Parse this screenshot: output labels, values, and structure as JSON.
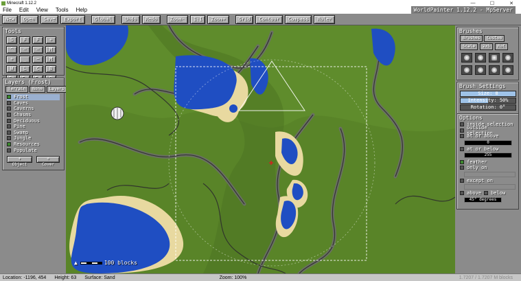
{
  "window": {
    "title": "Minecraft 1.12.2",
    "app_title": "WorldPainter 1.12.2 - MpServer"
  },
  "menu": [
    "File",
    "Edit",
    "View",
    "Tools",
    "Help"
  ],
  "toolbar": [
    {
      "label": "New"
    },
    {
      "label": "Open"
    },
    {
      "label": "Save"
    },
    {
      "label": "Export"
    },
    {
      "label": "Global"
    },
    {
      "label": "Undo"
    },
    {
      "label": "Redo"
    },
    {
      "label": "Zoom-"
    },
    {
      "label": "1:1"
    },
    {
      "label": "Zoom+"
    },
    {
      "label": "Grid"
    },
    {
      "label": "Contour"
    },
    {
      "label": "Compass"
    },
    {
      "label": "Ruler"
    }
  ],
  "tools": {
    "title": "Tools",
    "buttons": [
      "S",
      "F",
      "F",
      "+",
      "^",
      "~",
      "~",
      "M",
      "+",
      "_",
      "~",
      "M",
      "W",
      "L",
      "C",
      "B",
      "Bi",
      "Fy",
      "Er",
      "D"
    ]
  },
  "layers": {
    "title": "Layers (Frost)",
    "tabs": [
      "Terrain",
      "None",
      "Layers"
    ],
    "items": [
      {
        "name": "Frost",
        "checked": true,
        "selected": true
      },
      {
        "name": "Caves",
        "checked": false
      },
      {
        "name": "Caverns",
        "checked": false
      },
      {
        "name": "Chasms",
        "checked": false
      },
      {
        "name": "Deciduous",
        "checked": false
      },
      {
        "name": "Pine",
        "checked": false
      },
      {
        "name": "Swamp",
        "checked": false
      },
      {
        "name": "Jungle",
        "checked": false
      },
      {
        "name": "Resources",
        "checked": true
      },
      {
        "name": "Populate",
        "checked": false
      }
    ],
    "actions": [
      "+ Object",
      "+ Cover"
    ]
  },
  "brushes": {
    "title": "Brushes",
    "tabs": [
      "Brushes",
      "Custom"
    ],
    "sub": [
      "Scale",
      "2x5",
      "Rot"
    ]
  },
  "brush_settings": {
    "title": "Brush Settings",
    "size_label": "Size: 8",
    "intensity_label": "Intensity: 50%",
    "intensity": 0.5,
    "rotation_label": "Rotation: 0°",
    "size": 0.08
  },
  "options": {
    "title": "Options",
    "inside_selection": "inside selection",
    "outside_selection": "outside selection",
    "at_or_above": "at or above",
    "at_or_above_value": "0",
    "at_or_below": "at or below",
    "at_or_below_value": "255",
    "feather": "feather",
    "only_on": "only on",
    "except_on": "except on",
    "above": "above",
    "below": "below",
    "degrees": "45° degrees"
  },
  "map": {
    "scale_label": "100 blocks"
  },
  "status": {
    "location": "Location: -1196, 454",
    "height": "Height: 63",
    "surface": "Surface: Sand",
    "zoom": "Zoom: 100%",
    "extra": "1.7207 / 1.7207 M blocks"
  },
  "colors": {
    "grass": "#5f8c2c",
    "water": "#1f4ec2",
    "sand": "#e8d9a0",
    "cliff": "#6d6d6d"
  }
}
